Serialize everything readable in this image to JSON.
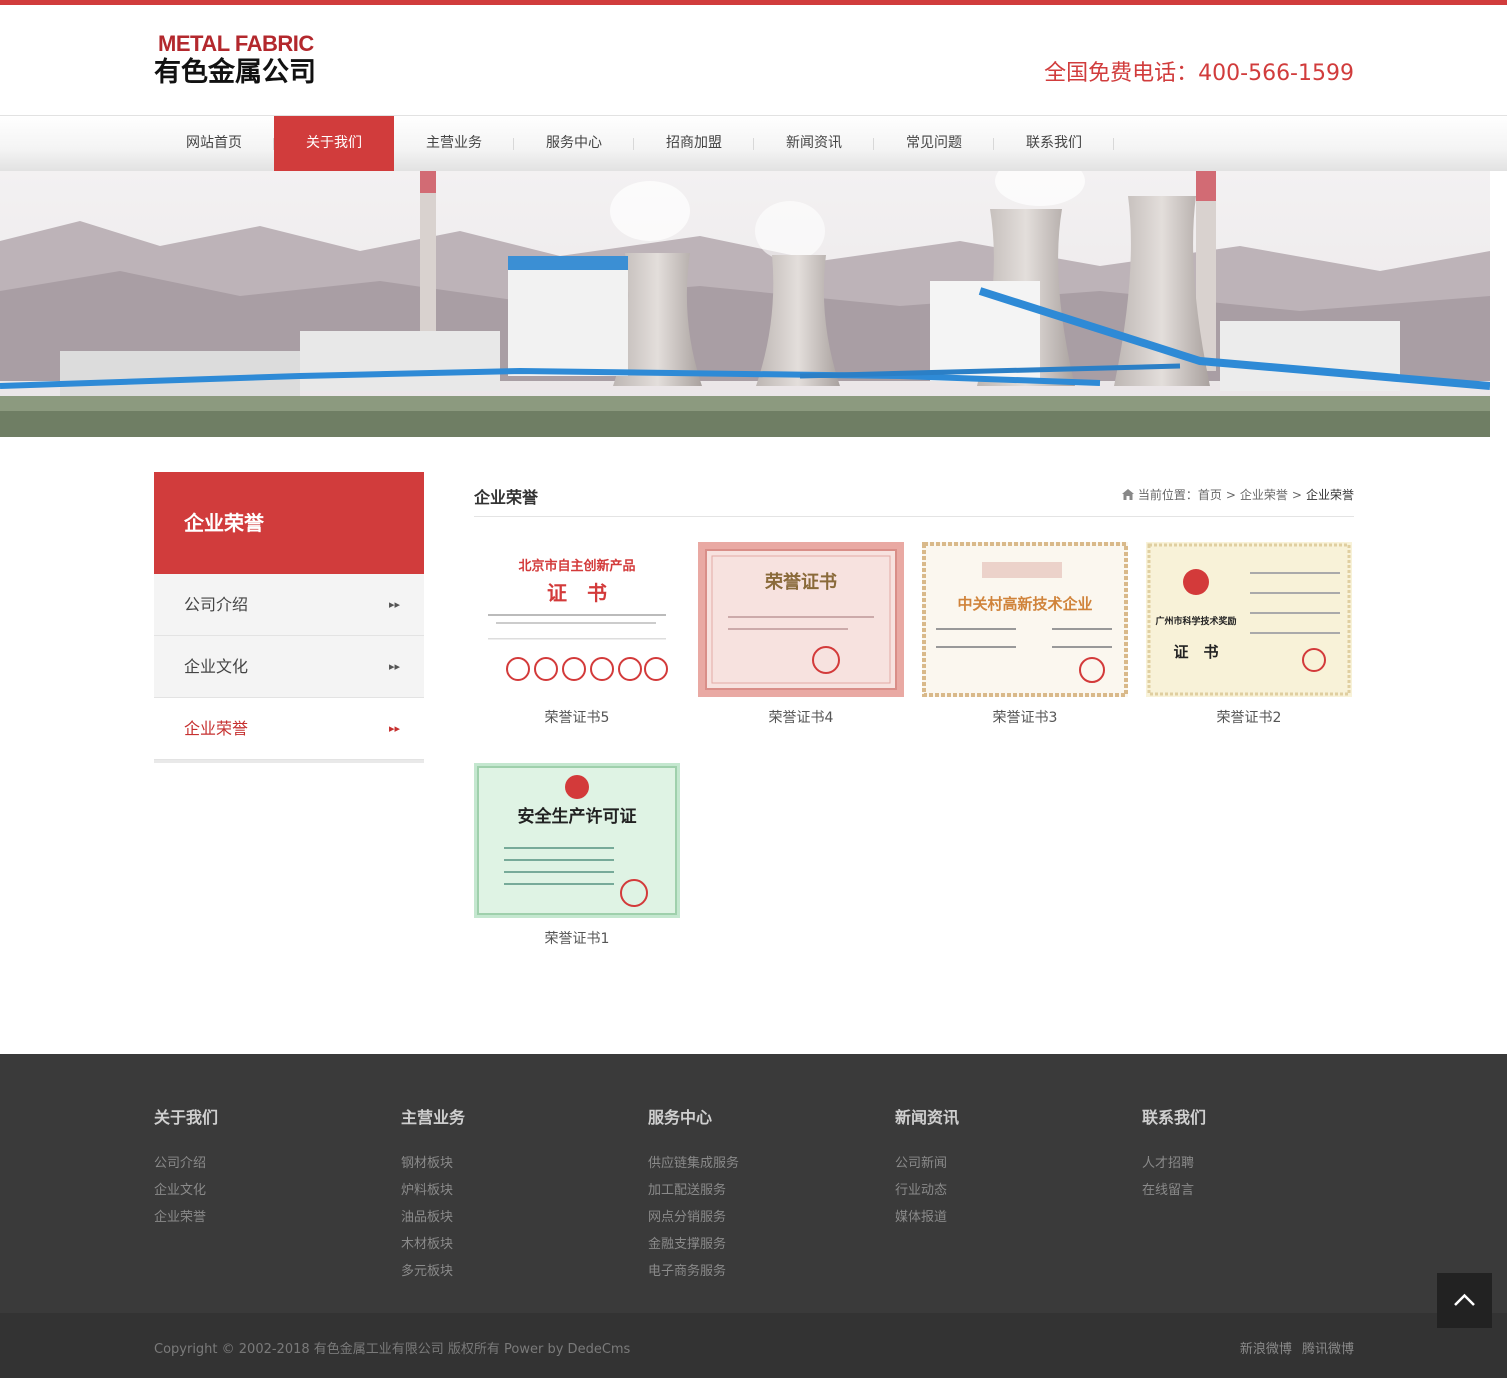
{
  "header": {
    "logo_en": "METAL FABRIC",
    "logo_cn": "有色金属公司",
    "hotline": "全国免费电话：400-566-1599"
  },
  "nav": {
    "items": [
      {
        "label": "网站首页"
      },
      {
        "label": "关于我们"
      },
      {
        "label": "主营业务"
      },
      {
        "label": "服务中心"
      },
      {
        "label": "招商加盟"
      },
      {
        "label": "新闻资讯"
      },
      {
        "label": "常见问题"
      },
      {
        "label": "联系我们"
      }
    ],
    "active_index": 1
  },
  "sidebar": {
    "title": "企业荣誉",
    "items": [
      {
        "label": "公司介绍"
      },
      {
        "label": "企业文化"
      },
      {
        "label": "企业荣誉"
      }
    ],
    "active_index": 2
  },
  "content": {
    "title": "企业荣誉",
    "breadcrumb": {
      "prefix": "当前位置：",
      "items": [
        "首页",
        "企业荣誉",
        "企业荣誉"
      ]
    },
    "gallery": [
      {
        "caption": "荣誉证书5",
        "cert_title": "北京市自主创新产品",
        "cert_sub": "证　书"
      },
      {
        "caption": "荣誉证书4",
        "cert_title": "荣誉证书"
      },
      {
        "caption": "荣誉证书3",
        "cert_title": "中关村高新技术企业"
      },
      {
        "caption": "荣誉证书2",
        "cert_title": "广州市科学技术奖励",
        "cert_sub": "证　书"
      },
      {
        "caption": "荣誉证书1",
        "cert_title": "安全生产许可证"
      }
    ]
  },
  "footer": {
    "columns": [
      {
        "title": "关于我们",
        "links": [
          "公司介绍",
          "企业文化",
          "企业荣誉"
        ]
      },
      {
        "title": "主营业务",
        "links": [
          "钢材板块",
          "炉料板块",
          "油品板块",
          "木材板块",
          "多元板块"
        ]
      },
      {
        "title": "服务中心",
        "links": [
          "供应链集成服务",
          "加工配送服务",
          "网点分销服务",
          "金融支撑服务",
          "电子商务服务"
        ]
      },
      {
        "title": "新闻资讯",
        "links": [
          "公司新闻",
          "行业动态",
          "媒体报道"
        ]
      },
      {
        "title": "联系我们",
        "links": [
          "人才招聘",
          "在线留言"
        ]
      }
    ],
    "copyright": "Copyright © 2002-2018 有色金属工业有限公司 版权所有 Power by DedeCms",
    "social": [
      "新浪微博",
      "腾讯微博"
    ]
  },
  "colors": {
    "accent": "#d13c3c",
    "footer_bg": "#3a3a3a"
  },
  "icons": {
    "breadcrumb": "home-icon",
    "sidebar_arrow": "double-chevron-right-icon",
    "backtop": "chevron-up-icon"
  }
}
